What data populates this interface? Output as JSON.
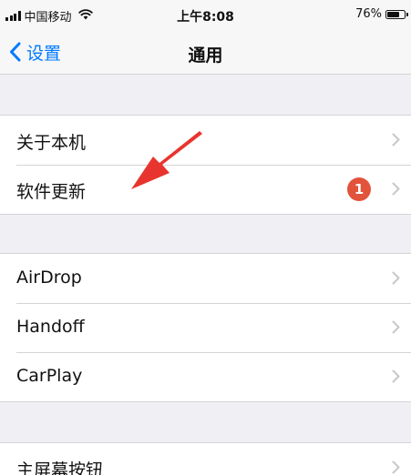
{
  "status_bar": {
    "carrier": "中国移动",
    "time": "上午8:08",
    "battery_percent": "76%",
    "battery_level": 0.76,
    "icons": [
      "signal-icon",
      "wifi-icon",
      "battery-icon"
    ]
  },
  "nav": {
    "back_label": "设置",
    "back_icon": "chevron-left-icon",
    "title": "通用"
  },
  "groups": [
    {
      "rows": [
        {
          "label": "关于本机"
        },
        {
          "label": "软件更新",
          "badge": "1"
        }
      ]
    },
    {
      "rows": [
        {
          "label": "AirDrop"
        },
        {
          "label": "Handoff"
        },
        {
          "label": "CarPlay"
        }
      ]
    },
    {
      "rows": [
        {
          "label": "主屏幕按钮"
        }
      ]
    }
  ],
  "colors": {
    "accent": "#007aff",
    "badge": "#e2533b",
    "annotation_arrow": "#e8342e",
    "background": "#efeff4",
    "chevron": "#c7c7cc"
  },
  "annotation": {
    "type": "arrow",
    "points_to": "软件更新"
  }
}
